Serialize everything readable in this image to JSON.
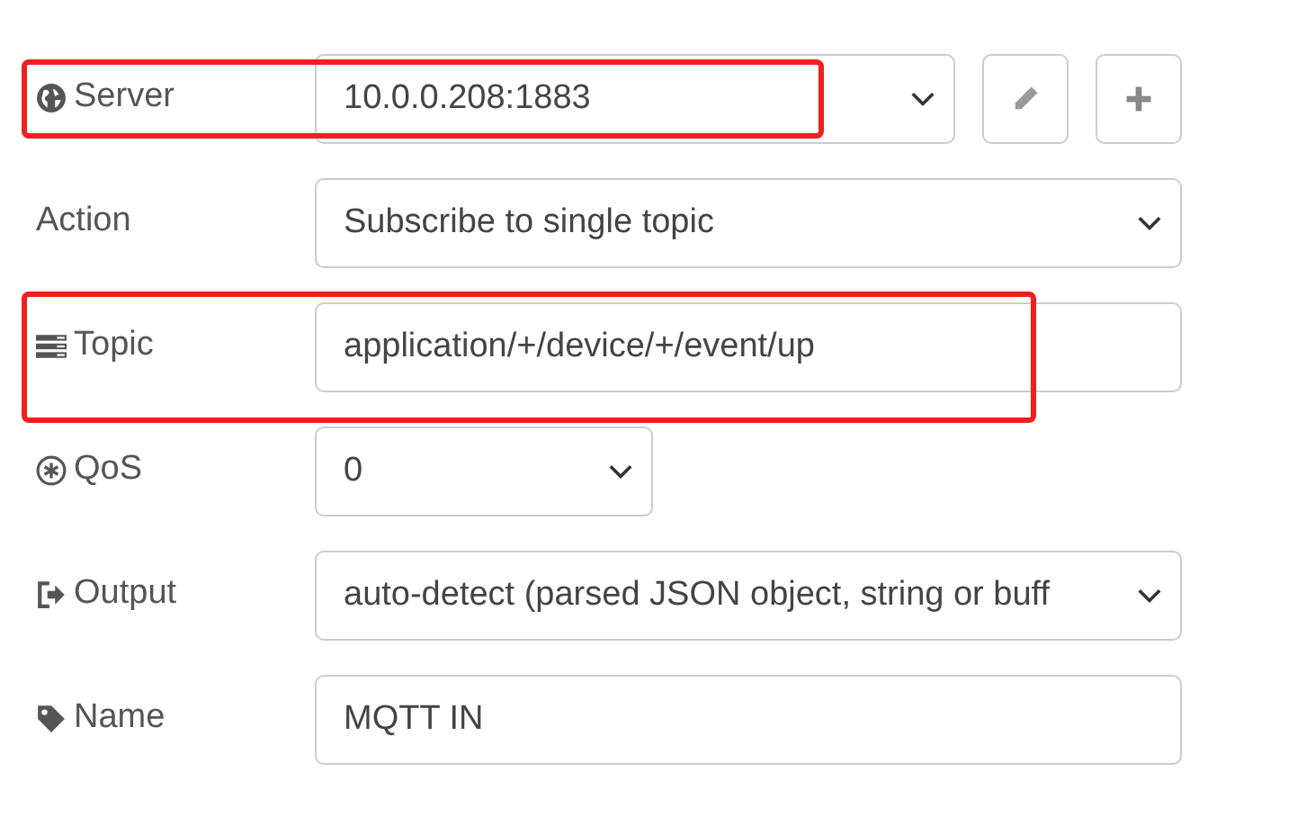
{
  "rows": [
    {
      "label": "Server",
      "kind": "select",
      "value": "10.0.0.208:1883",
      "highlighted": true
    },
    {
      "label": "Action",
      "kind": "select",
      "value": "Subscribe to single topic",
      "highlighted": false
    },
    {
      "label": "Topic",
      "kind": "input",
      "value": "application/+/device/+/event/up",
      "highlighted": true
    },
    {
      "label": "QoS",
      "kind": "select",
      "value": "0",
      "highlighted": false
    },
    {
      "label": "Output",
      "kind": "select",
      "value": "auto-detect (parsed JSON object, string or buff",
      "highlighted": false
    },
    {
      "label": "Name",
      "kind": "input",
      "value": "MQTT IN",
      "highlighted": false
    }
  ]
}
